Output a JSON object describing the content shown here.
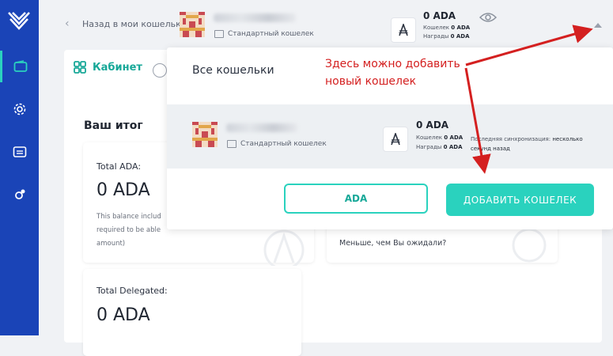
{
  "nav": {
    "back_label": "Назад в мои кошельки"
  },
  "header_wallet": {
    "type_label": "Стандартный кошелек",
    "balance": "0 ADA",
    "wallet_line_label": "Кошелек",
    "wallet_line_value": "0 ADA",
    "rewards_line_label": "Награды",
    "rewards_line_value": "0 ADA"
  },
  "tabs": [
    {
      "label": "Кабинет"
    }
  ],
  "summary": {
    "title": "Ваш итог",
    "total_ada_label": "Total ADA:",
    "total_ada_value": "0 ADA",
    "total_ada_note_1": "This balance includ",
    "total_ada_note_2": "required to be able",
    "total_ada_note_3": "amount)",
    "total_delegated_label": "Total Delegated:",
    "total_delegated_value": "0 ADA",
    "right_card_question": "Меньше, чем Вы ожидали?"
  },
  "panel": {
    "title": "Все кошельки",
    "wallet": {
      "type_label": "Стандартный кошелек",
      "balance": "0 ADA",
      "wallet_line_label": "Кошелек",
      "wallet_line_value": "0 ADA",
      "rewards_line_label": "Награды",
      "rewards_line_value": "0 ADA",
      "sync_label": "Последняя синхронизация:",
      "sync_value_1": "несколько",
      "sync_value_2": "секунд назад"
    },
    "ada_button": "ADA",
    "add_button": "ДОБАВИТЬ КОШЕЛЕК"
  },
  "annotation": {
    "line1": "Здесь можно добавить",
    "line2": "новый кошелек"
  },
  "colors": {
    "sidebar": "#1a44b7",
    "accent": "#2ad2be",
    "annotation": "#d42020"
  }
}
